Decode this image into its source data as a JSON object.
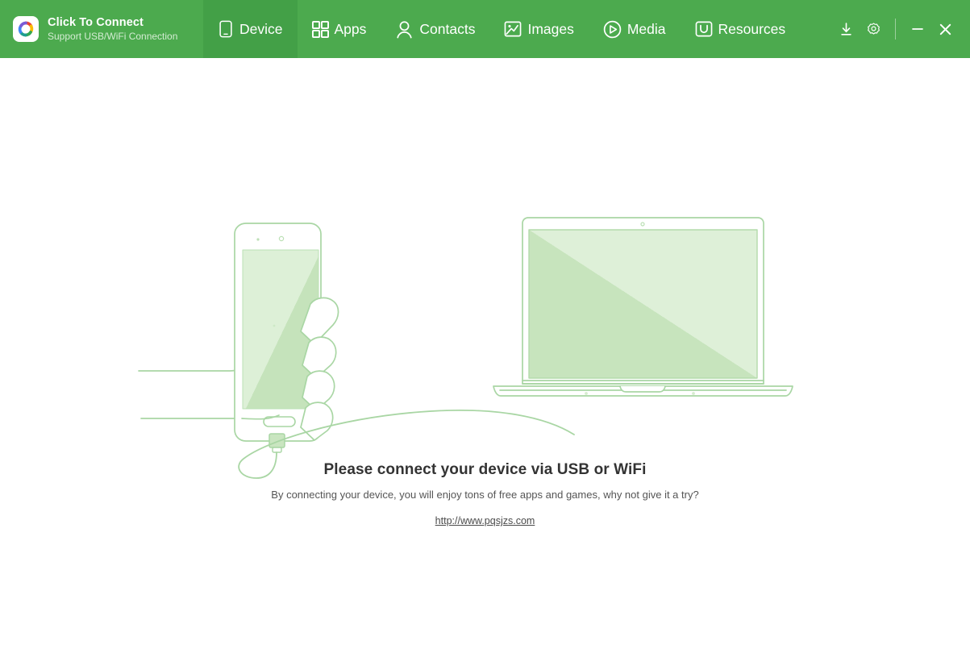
{
  "window": {
    "brand": {
      "title": "Click To Connect",
      "subtitle": "Support USB/WiFi Connection",
      "logo_icon": "pinwheel-logo-icon",
      "logo_colors": [
        "#4285F4",
        "#EA4335",
        "#FBBC05",
        "#34A853"
      ]
    },
    "colors": {
      "header_green": "#4CAA4E",
      "active_tab_green": "#43A047",
      "illustration_line": "#A9D6A4",
      "illustration_fill_light": "#DCEFD6",
      "illustration_fill_dark": "#C6E4BC",
      "body_background": "#FFFFFF"
    },
    "controls": [
      {
        "name": "download-icon",
        "label": "Download"
      },
      {
        "name": "gear-icon",
        "label": "Settings"
      },
      {
        "name": "minimize-icon",
        "label": "Minimize"
      },
      {
        "name": "close-icon",
        "label": "Close"
      }
    ]
  },
  "nav": {
    "tabs": [
      {
        "label": "Device",
        "icon": "phone-icon",
        "active": true
      },
      {
        "label": "Apps",
        "icon": "grid-icon",
        "active": false
      },
      {
        "label": "Contacts",
        "icon": "person-icon",
        "active": false
      },
      {
        "label": "Images",
        "icon": "picture-icon",
        "active": false
      },
      {
        "label": "Media",
        "icon": "play-icon",
        "active": false
      },
      {
        "label": "Resources",
        "icon": "toolbox-icon",
        "active": false
      }
    ]
  },
  "main": {
    "illustration": "hand-holding-phone-connected-by-usb-cable-to-laptop",
    "title": "Please connect your device via USB or WiFi",
    "subtitle": "By connecting your device, you will enjoy tons of free apps and games, why not give it a try?",
    "link": "http://www.pqsjzs.com"
  }
}
